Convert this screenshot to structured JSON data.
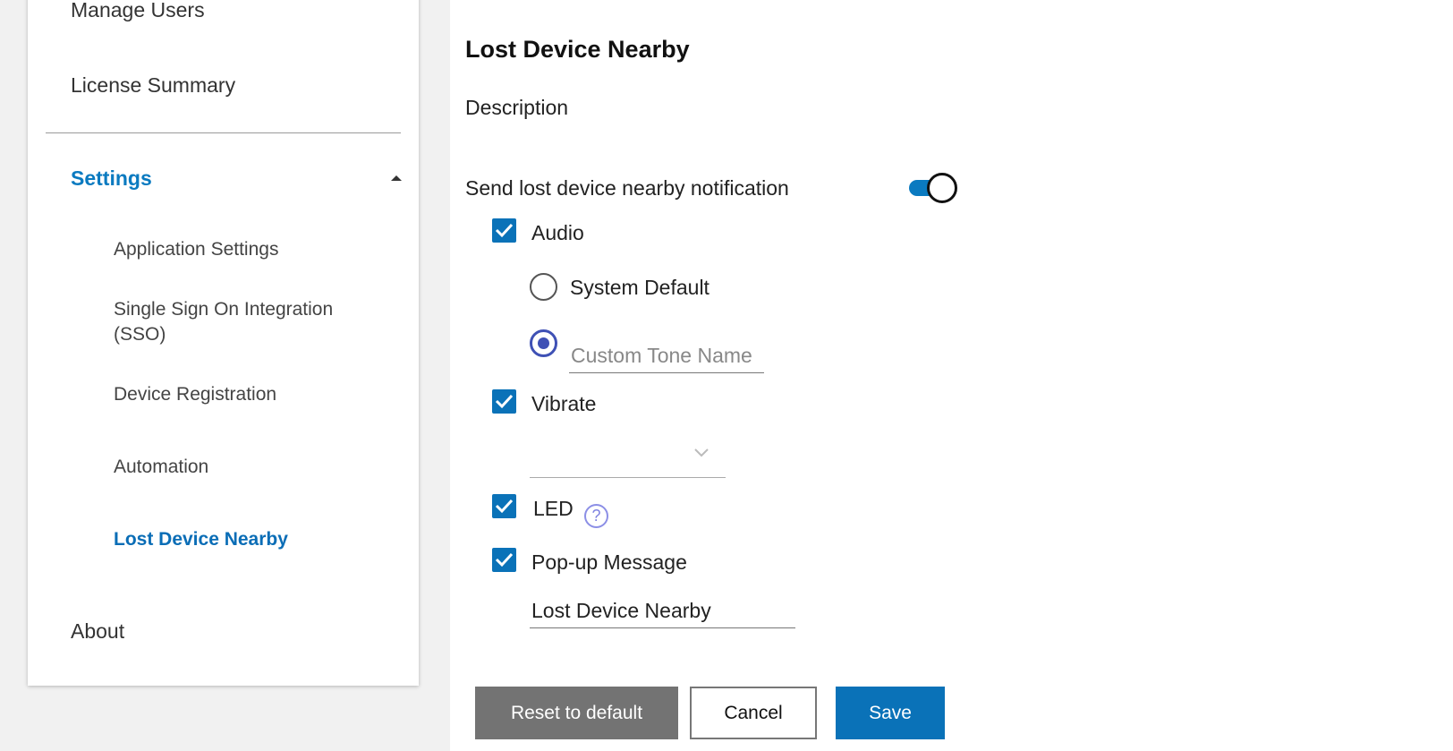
{
  "sidebar": {
    "manage_users": "Manage Users",
    "license_summary": "License Summary",
    "settings": "Settings",
    "sub_items": {
      "application_settings": "Application Settings",
      "sso_line1": "Single Sign On Integration",
      "sso_line2": "(SSO)",
      "device_registration": "Device Registration",
      "automation": "Automation",
      "lost_device_nearby": "Lost Device Nearby"
    },
    "about": "About"
  },
  "main": {
    "title": "Lost Device Nearby",
    "description_label": "Description",
    "notification_label": "Send lost device nearby notification",
    "notification_enabled": true,
    "audio": {
      "label": "Audio",
      "checked": true,
      "system_default_label": "System Default",
      "custom_tone_placeholder": "Custom Tone Name",
      "custom_tone_value": "",
      "selected": "custom"
    },
    "vibrate": {
      "label": "Vibrate",
      "checked": true,
      "selected_value": ""
    },
    "led": {
      "label": "LED",
      "checked": true,
      "help_icon": "?"
    },
    "popup": {
      "label": "Pop-up Message",
      "checked": true,
      "message_value": "Lost Device Nearby"
    },
    "buttons": {
      "reset": "Reset to default",
      "cancel": "Cancel",
      "save": "Save"
    }
  },
  "colors": {
    "accent": "#0a72b8",
    "radio_selected": "#3f51b5",
    "help_icon": "#7e82e0",
    "reset_button": "#737373"
  },
  "icons": {
    "collapse": "caret-up-icon",
    "check": "check-icon",
    "dropdown": "chevron-down-icon",
    "help": "question-circle-icon"
  }
}
